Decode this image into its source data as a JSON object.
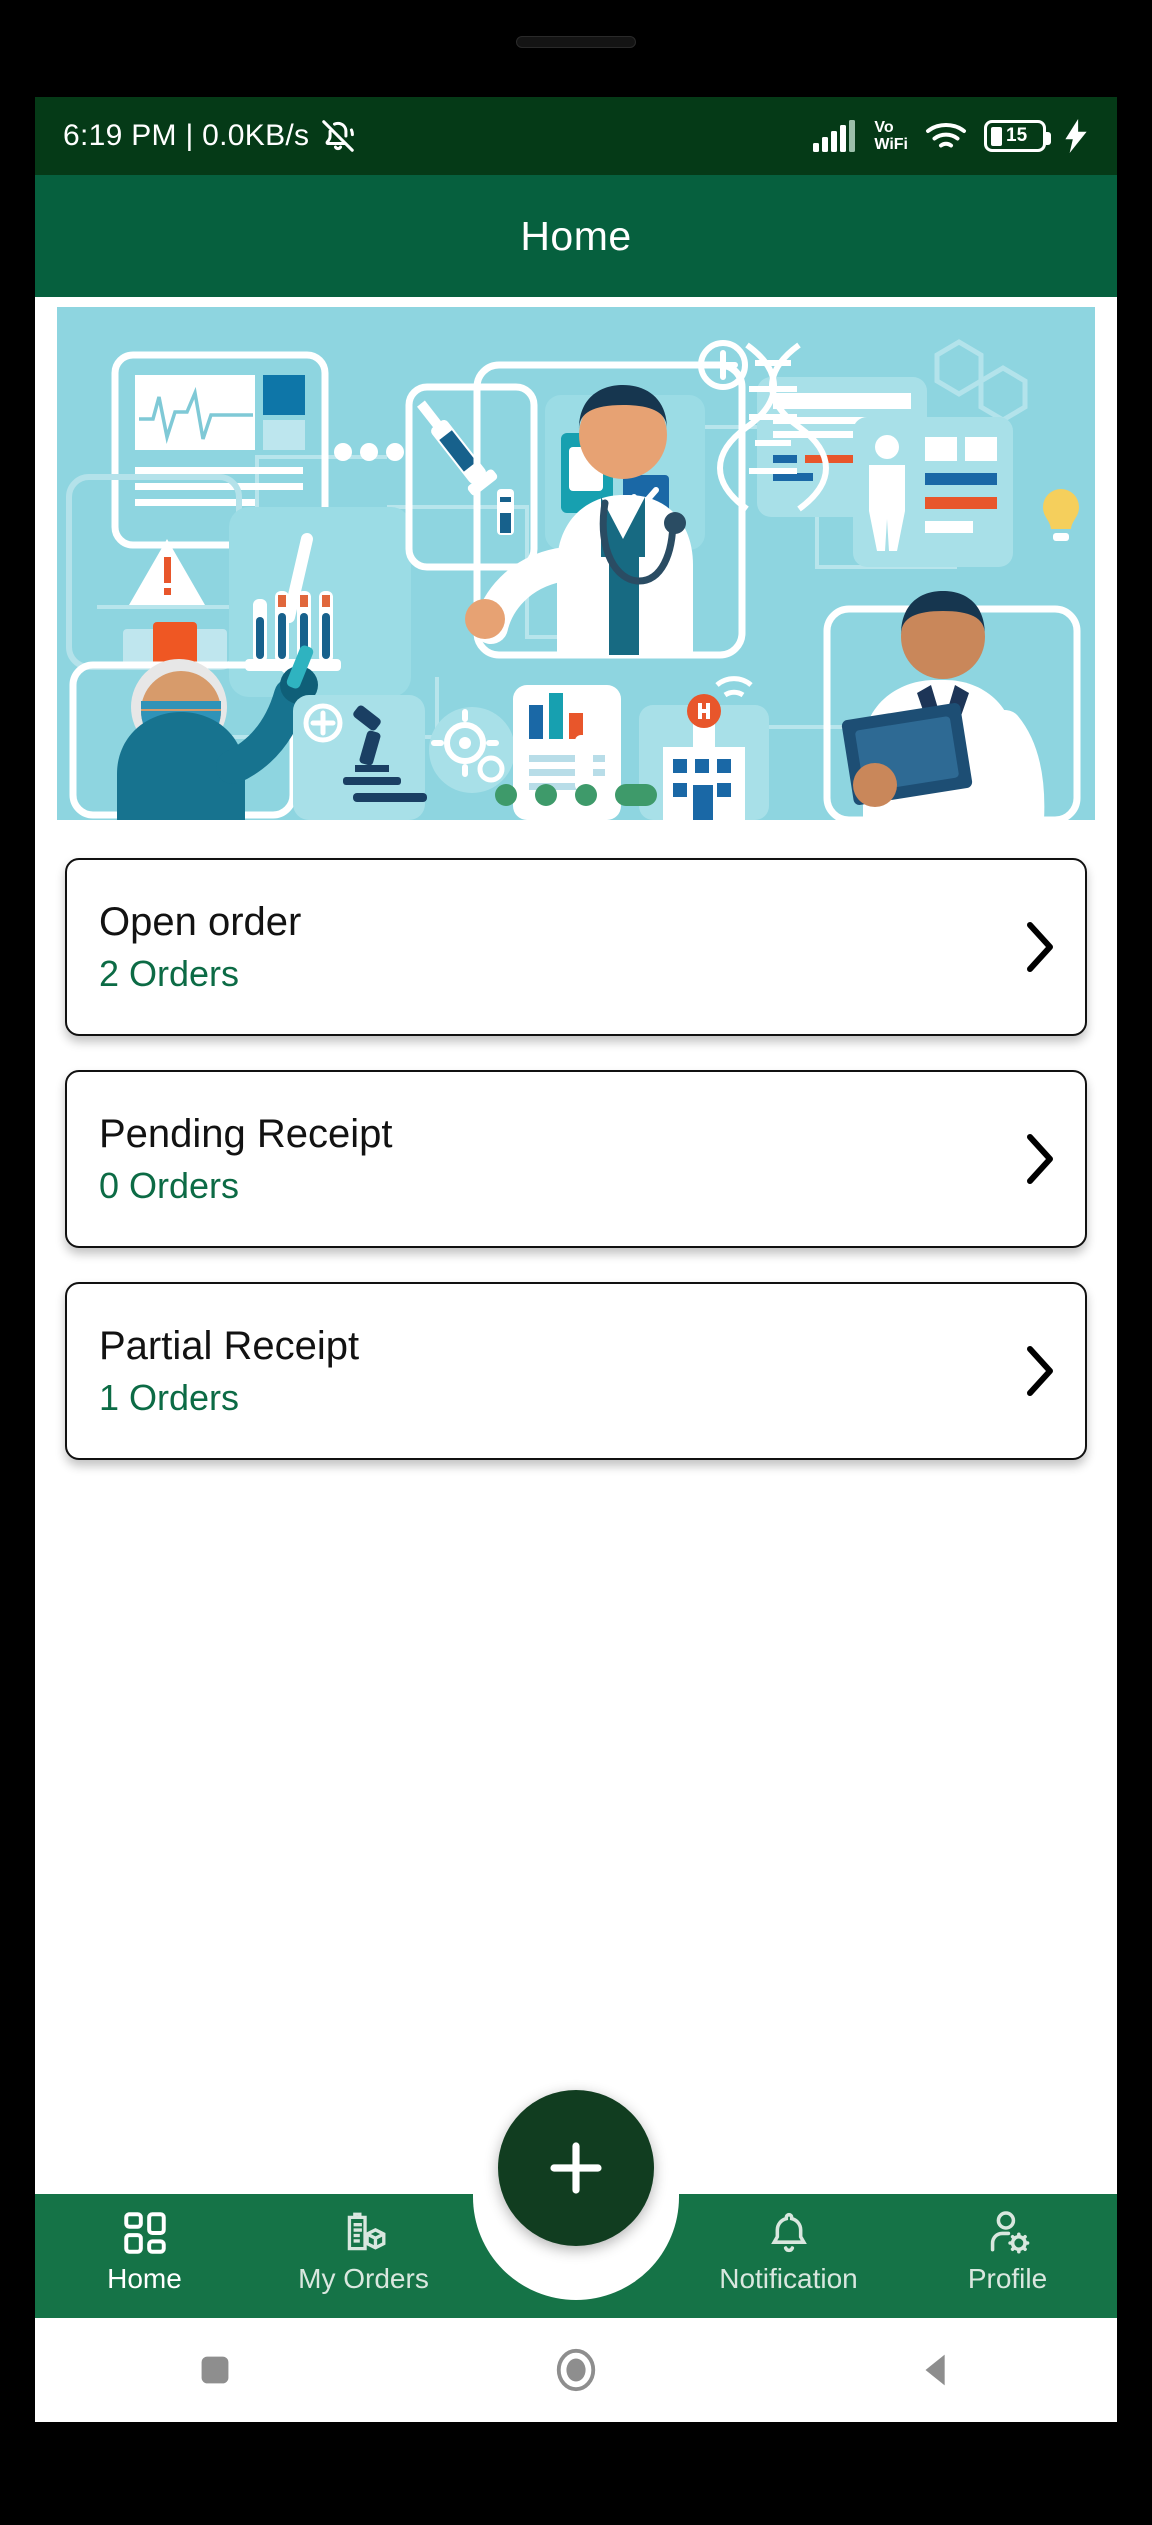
{
  "status_bar": {
    "time_and_network": "6:19 PM | 0.0KB/s",
    "mute_icon": "bell-muted-icon",
    "signal_icon": "cellular-signal-icon",
    "vowifi_line1": "Vo",
    "vowifi_line2": "WiFi",
    "wifi_icon": "wifi-icon",
    "battery_level": "15",
    "charging_icon": "charging-bolt-icon",
    "background_color": "#053A17"
  },
  "app_bar": {
    "title": "Home",
    "background_color": "#06603E"
  },
  "banner": {
    "alt": "healthcare-illustration",
    "background_color": "#8ED5E0",
    "dots": [
      {
        "active": false
      },
      {
        "active": false
      },
      {
        "active": false
      },
      {
        "active": true
      }
    ]
  },
  "cards": [
    {
      "title": "Open order",
      "count": "2 Orders",
      "chevron": "chevron-right-icon"
    },
    {
      "title": "Pending Receipt",
      "count": "0 Orders",
      "chevron": "chevron-right-icon"
    },
    {
      "title": "Partial Receipt",
      "count": "1 Orders",
      "chevron": "chevron-right-icon"
    }
  ],
  "fab": {
    "icon": "plus-icon",
    "background_color": "#113D20"
  },
  "bottom_nav": {
    "background_color": "#157347",
    "items": [
      {
        "label": "Home",
        "icon": "dashboard-grid-icon",
        "active": true
      },
      {
        "label": "My Orders",
        "icon": "clipboard-box-icon",
        "active": false
      },
      {
        "label": "Notification",
        "icon": "bell-icon",
        "active": false
      },
      {
        "label": "Profile",
        "icon": "user-gear-icon",
        "active": false
      }
    ]
  },
  "android_nav": {
    "recents": "square-recents-icon",
    "home": "circle-home-icon",
    "back": "triangle-back-icon"
  },
  "theme": {
    "green_dark": "#053A17",
    "green_header": "#06603E",
    "green_nav": "#157347",
    "green_text": "#0C6B45",
    "banner_cyan": "#8ED5E0"
  }
}
